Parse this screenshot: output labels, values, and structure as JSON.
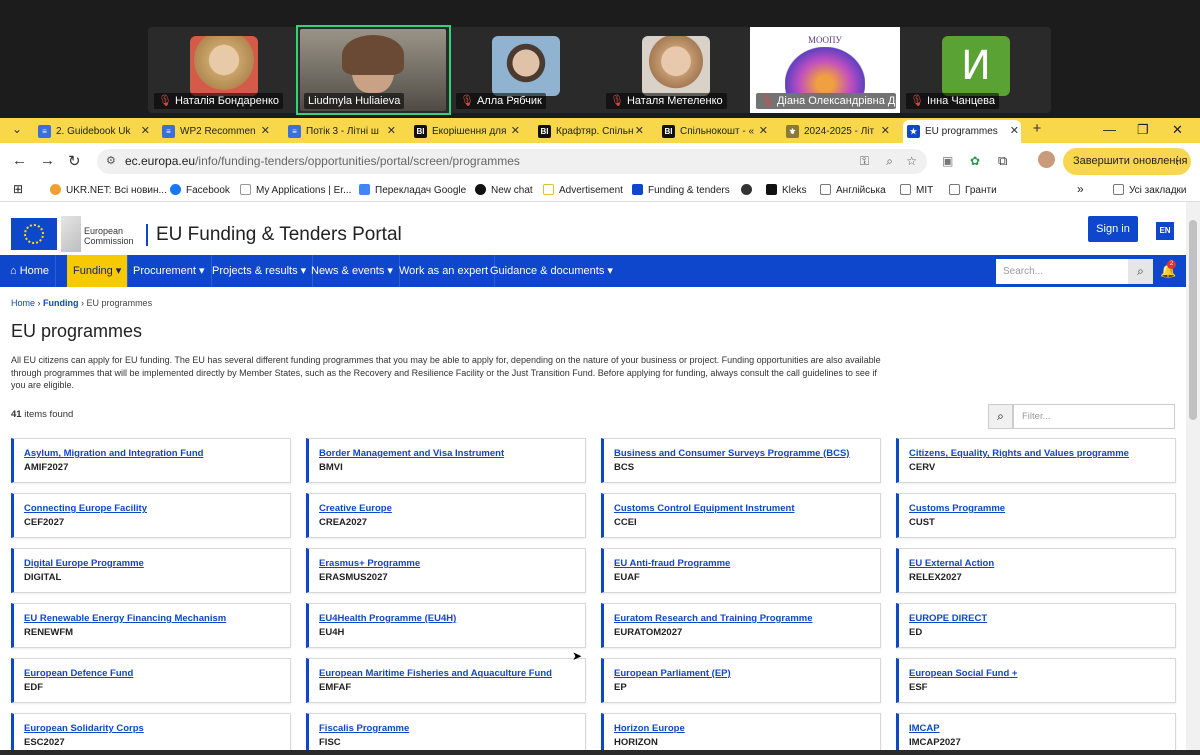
{
  "meeting": {
    "participants": [
      {
        "name": "Наталія Бондаренко",
        "muted": true,
        "avatar_color": "#c9a46a"
      },
      {
        "name": "Liudmyla Huliaieva",
        "muted": false,
        "active": true
      },
      {
        "name": "Алла Рябчик",
        "muted": true,
        "avatar_color": "#5d86a8"
      },
      {
        "name": "Наталя Метеленко",
        "muted": true,
        "avatar_color": "#c7a991"
      },
      {
        "name": "Діана Олександрівна Де...",
        "muted": true,
        "avatar_color": "#ffffff",
        "logo_text": "МООПУ"
      },
      {
        "name": "Інна Чанцева",
        "muted": true,
        "avatar_color": "#5aa234",
        "letter": "И"
      }
    ]
  },
  "browser": {
    "tabs": [
      {
        "label": "2. Guidebook Uk",
        "icon_color": "#3b6fe0",
        "icon": "doc-icon"
      },
      {
        "label": "WP2 Recommen",
        "icon_color": "#3b6fe0",
        "icon": "doc-icon"
      },
      {
        "label": "Потік 3 - Літні ш",
        "icon_color": "#3b6fe0",
        "icon": "doc-icon"
      },
      {
        "label": "Екорішення для",
        "icon_color": "#111111",
        "icon": "bi-icon"
      },
      {
        "label": "Крафтяр. Спільн",
        "icon_color": "#111111",
        "icon": "bi-icon"
      },
      {
        "label": "Спільнокошт - «",
        "icon_color": "#111111",
        "icon": "bi-icon"
      },
      {
        "label": "2024-2025 - Літ",
        "icon_color": "#8a7a3a",
        "icon": "crest-icon"
      },
      {
        "label": "EU programmes",
        "icon_color": "#0e47cb",
        "icon": "eu-flag-icon",
        "active": true
      }
    ],
    "url_host": "ec.europa.eu",
    "url_path": "/info/funding-tenders/opportunities/portal/screen/programmes",
    "update_button": "Завершити оновлення",
    "bookmarks": [
      {
        "label": "UKR.NET: Всі новин...",
        "color": "#f0a030"
      },
      {
        "label": "Facebook",
        "color": "#1877f2"
      },
      {
        "label": "My Applications | Er...",
        "color": "#999999"
      },
      {
        "label": "Перекладач Google",
        "color": "#4285f4"
      },
      {
        "label": "New chat",
        "color": "#111111"
      },
      {
        "label": "Advertisement",
        "color": "#e0c030"
      },
      {
        "label": "Funding & tenders",
        "color": "#0e47cb"
      },
      {
        "label": "",
        "color": "#333333"
      },
      {
        "label": "Kleks",
        "color": "#111111"
      },
      {
        "label": "Англійська",
        "color": "#777777"
      },
      {
        "label": "MIT",
        "color": "#777777"
      },
      {
        "label": "Гранти",
        "color": "#777777"
      }
    ],
    "all_bookmarks": "Усі закладки"
  },
  "portal": {
    "ec_name": "European Commission",
    "title": "EU Funding & Tenders Portal",
    "signin": "Sign in",
    "lang": "EN",
    "notif_count": "2",
    "nav": [
      {
        "label": "Home",
        "selected": false
      },
      {
        "label": "Funding ▾",
        "selected": true
      },
      {
        "label": "Procurement ▾",
        "selected": false
      },
      {
        "label": "Projects & results ▾",
        "selected": false
      },
      {
        "label": "News & events ▾",
        "selected": false
      },
      {
        "label": "Work as an expert",
        "selected": false
      },
      {
        "label": "Guidance & documents ▾",
        "selected": false
      }
    ],
    "search_placeholder": "Search...",
    "breadcrumb": {
      "home": "Home",
      "funding": "Funding",
      "current": "EU programmes"
    },
    "page_title": "EU programmes",
    "intro": "All EU citizens can apply for EU funding. The EU has several different funding programmes that you may be able to apply for, depending on the nature of your business or project. Funding opportunities are also available through programmes that will be implemented directly by Member States, such as the Recovery and Resilience Facility or the Just Transition Fund. Before applying for funding, always consult the call guidelines to see if you are eligible.",
    "items_count": "41",
    "items_found": "items found",
    "filter_placeholder": "Filter...",
    "programmes": [
      {
        "name": "Asylum, Migration and Integration Fund",
        "code": "AMIF2027"
      },
      {
        "name": "Border Management and Visa Instrument",
        "code": "BMVI"
      },
      {
        "name": "Business and Consumer Surveys Programme (BCS)",
        "code": "BCS"
      },
      {
        "name": "Citizens, Equality, Rights and Values programme",
        "code": "CERV"
      },
      {
        "name": "Connecting Europe Facility",
        "code": "CEF2027"
      },
      {
        "name": "Creative Europe",
        "code": "CREA2027"
      },
      {
        "name": "Customs Control Equipment Instrument",
        "code": "CCEI"
      },
      {
        "name": "Customs Programme",
        "code": "CUST"
      },
      {
        "name": "Digital Europe Programme",
        "code": "DIGITAL"
      },
      {
        "name": "Erasmus+ Programme",
        "code": "ERASMUS2027"
      },
      {
        "name": "EU Anti-fraud Programme",
        "code": "EUAF"
      },
      {
        "name": "EU External Action",
        "code": "RELEX2027"
      },
      {
        "name": "EU Renewable Energy Financing Mechanism",
        "code": "RENEWFM"
      },
      {
        "name": "EU4Health Programme (EU4H)",
        "code": "EU4H"
      },
      {
        "name": "Euratom Research and Training Programme",
        "code": "EURATOM2027"
      },
      {
        "name": "EUROPE DIRECT",
        "code": "ED"
      },
      {
        "name": "European Defence Fund",
        "code": "EDF"
      },
      {
        "name": "European Maritime Fisheries and Aquaculture Fund",
        "code": "EMFAF"
      },
      {
        "name": "European Parliament (EP)",
        "code": "EP"
      },
      {
        "name": "European Social Fund +",
        "code": "ESF"
      },
      {
        "name": "European Solidarity Corps",
        "code": "ESC2027"
      },
      {
        "name": "Fiscalis Programme",
        "code": "FISC"
      },
      {
        "name": "Horizon Europe",
        "code": "HORIZON"
      },
      {
        "name": "IMCAP",
        "code": "IMCAP2027"
      }
    ]
  }
}
